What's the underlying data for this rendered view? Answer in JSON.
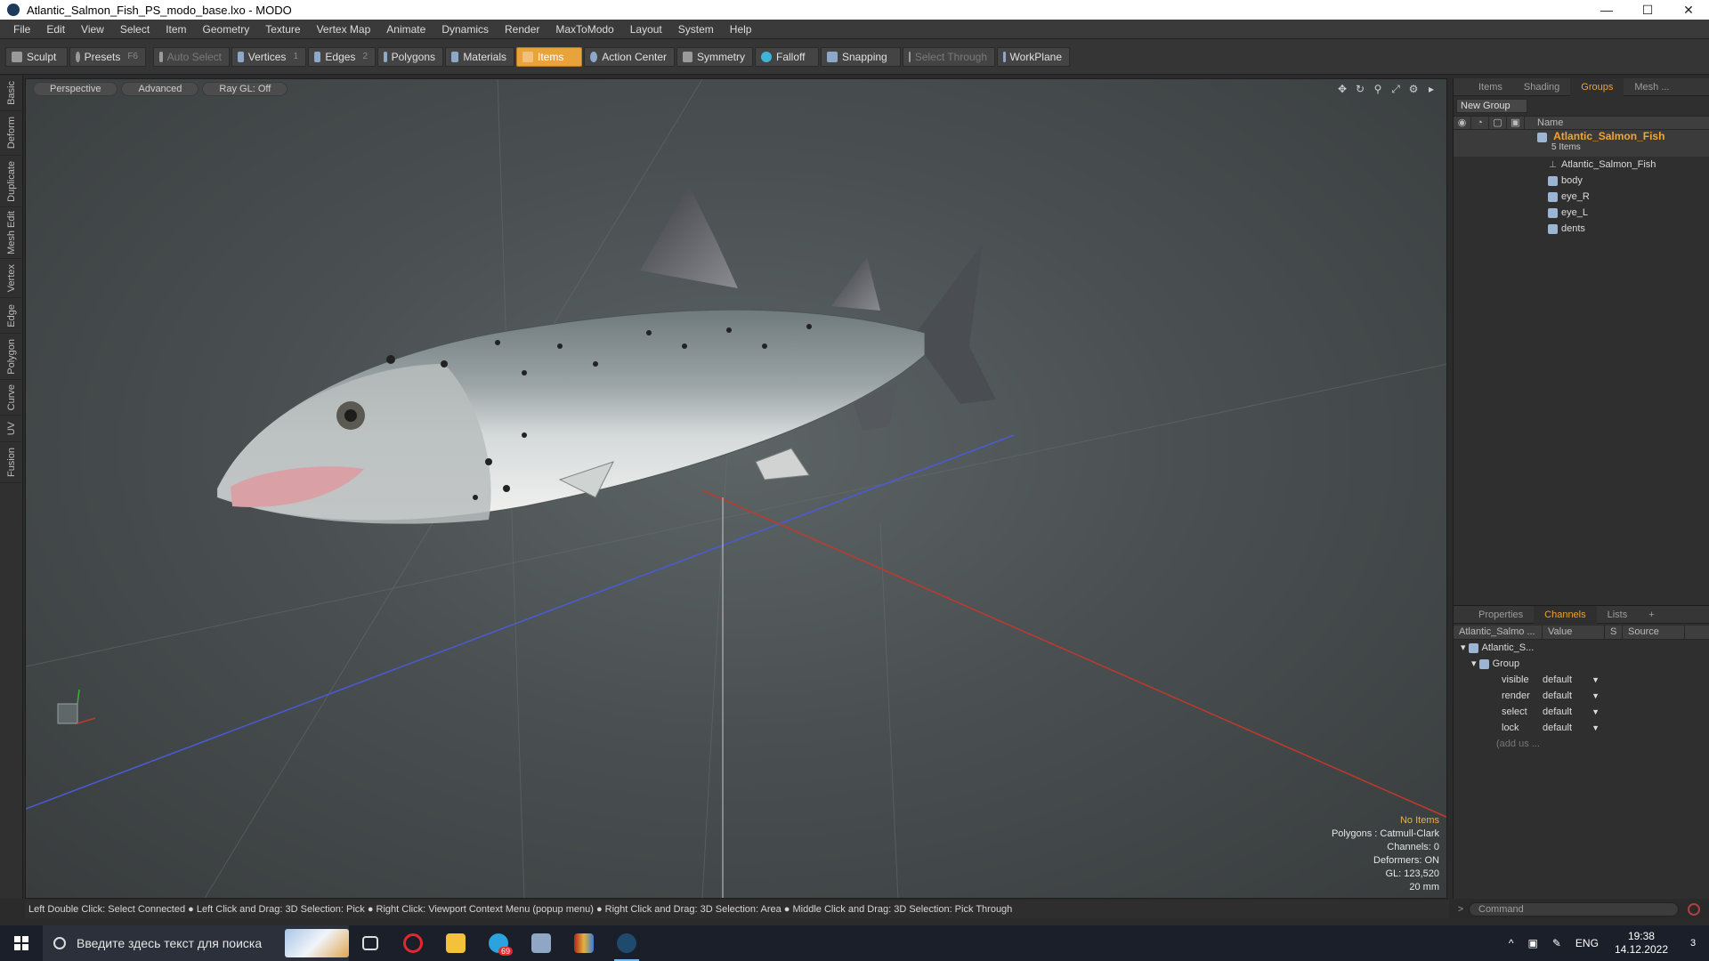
{
  "window": {
    "title": "Atlantic_Salmon_Fish_PS_modo_base.lxo - MODO",
    "controls": [
      "—",
      "☐",
      "✕"
    ]
  },
  "menu": [
    "File",
    "Edit",
    "View",
    "Select",
    "Item",
    "Geometry",
    "Texture",
    "Vertex Map",
    "Animate",
    "Dynamics",
    "Render",
    "MaxToModo",
    "Layout",
    "System",
    "Help"
  ],
  "toolbar": {
    "sculpt": "Sculpt",
    "presets": "Presets",
    "presets_key": "F6",
    "auto_select": "Auto Select",
    "vertices": "Vertices",
    "vertices_num": "1",
    "edges": "Edges",
    "edges_num": "2",
    "polygons": "Polygons",
    "materials": "Materials",
    "items": "Items",
    "action_center": "Action Center",
    "symmetry": "Symmetry",
    "falloff": "Falloff",
    "snapping": "Snapping",
    "select_through": "Select Through",
    "workplane": "WorkPlane"
  },
  "left_tabs": [
    "Basic",
    "Deform",
    "Duplicate",
    "Mesh Edit",
    "Vertex",
    "Edge",
    "Polygon",
    "Curve",
    "UV",
    "Fusion"
  ],
  "viewport": {
    "view_mode": "Perspective",
    "shading": "Advanced",
    "raygl": "Ray GL: Off",
    "info": {
      "selection": "No Items",
      "polygons": "Polygons : Catmull-Clark",
      "channels": "Channels: 0",
      "deformers": "Deformers: ON",
      "gl": "GL: 123,520",
      "scale": "20 mm"
    }
  },
  "right_top": {
    "tabs": [
      "Items",
      "Shading",
      "Groups",
      "Mesh ..."
    ],
    "active_tab": "Groups",
    "new_group": "New Group",
    "column_name": "Name",
    "group": {
      "name": "Atlantic_Salmon_Fish",
      "count": "5 Items",
      "children": [
        {
          "name": "Atlantic_Salmon_Fish",
          "icon": "locator-icon"
        },
        {
          "name": "body",
          "icon": "mesh-icon"
        },
        {
          "name": "eye_R",
          "icon": "mesh-icon"
        },
        {
          "name": "eye_L",
          "icon": "mesh-icon"
        },
        {
          "name": "dents",
          "icon": "mesh-icon"
        }
      ]
    }
  },
  "right_bottom": {
    "tabs": [
      "Properties",
      "Channels",
      "Lists",
      "+"
    ],
    "active_tab": "Channels",
    "columns": [
      "Atlantic_Salmo ...",
      "Value",
      "S",
      "Source"
    ],
    "root": "Atlantic_S...",
    "group": "Group",
    "channels": [
      {
        "name": "visible",
        "value": "default"
      },
      {
        "name": "render",
        "value": "default"
      },
      {
        "name": "select",
        "value": "default"
      },
      {
        "name": "lock",
        "value": "default"
      }
    ],
    "add_user": "(add us ..."
  },
  "command": {
    "prompt": ">",
    "placeholder": "Command"
  },
  "status": "Left Double Click: Select Connected ● Left Click and Drag: 3D Selection: Pick ● Right Click: Viewport Context Menu (popup menu) ● Right Click and Drag: 3D Selection: Area ● Middle Click and Drag: 3D Selection: Pick Through",
  "taskbar": {
    "search_placeholder": "Введите здесь текст для поиска",
    "lang": "ENG",
    "time": "19:38",
    "date": "14.12.2022",
    "notifications": "3",
    "telegram_badge": "69"
  },
  "colors": {
    "accent": "#e8a33a",
    "group_name": "#f0a531",
    "axis_x": "#c0392b",
    "axis_z": "#4a5bd4"
  }
}
